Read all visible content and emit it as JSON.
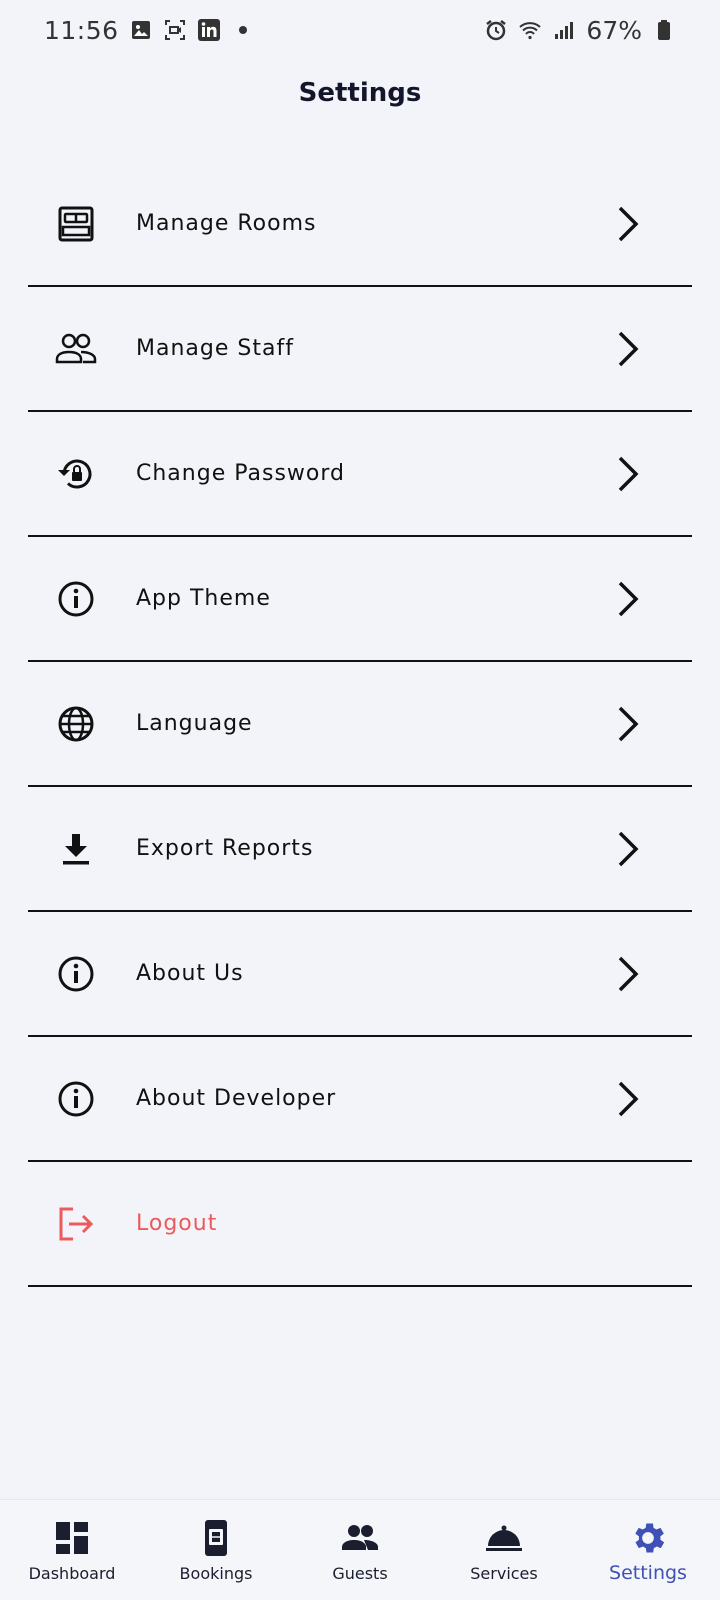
{
  "status_bar": {
    "time": "11:56",
    "battery": "67%",
    "left_icons": [
      "gallery-icon",
      "screen-record-icon",
      "linkedin-icon",
      "dot-icon"
    ],
    "right_icons": [
      "alarm-icon",
      "wifi-icon",
      "signal-icon",
      "battery-icon"
    ]
  },
  "header": {
    "title": "Settings"
  },
  "settings": {
    "items": [
      {
        "label": "Manage Rooms",
        "icon": "bed-icon"
      },
      {
        "label": "Manage Staff",
        "icon": "people-icon"
      },
      {
        "label": "Change Password",
        "icon": "lock-reset-icon"
      },
      {
        "label": "App Theme",
        "icon": "info-icon"
      },
      {
        "label": "Language",
        "icon": "globe-icon"
      },
      {
        "label": "Export Reports",
        "icon": "download-icon"
      },
      {
        "label": "About Us",
        "icon": "info-icon"
      },
      {
        "label": "About Developer",
        "icon": "info-icon"
      },
      {
        "label": "Logout",
        "icon": "logout-icon"
      }
    ]
  },
  "colors": {
    "background": "#f3f4f9",
    "title": "#14162b",
    "logout": "#ec5b5b",
    "active_tab": "#3f51b5",
    "nav_icon": "#1b1e2e"
  },
  "bottom_nav": {
    "items": [
      {
        "label": "Dashboard",
        "icon": "dashboard-icon"
      },
      {
        "label": "Bookings",
        "icon": "bookings-icon"
      },
      {
        "label": "Guests",
        "icon": "guests-icon"
      },
      {
        "label": "Services",
        "icon": "services-icon"
      },
      {
        "label": "Settings",
        "icon": "gear-icon",
        "active": true
      }
    ]
  }
}
